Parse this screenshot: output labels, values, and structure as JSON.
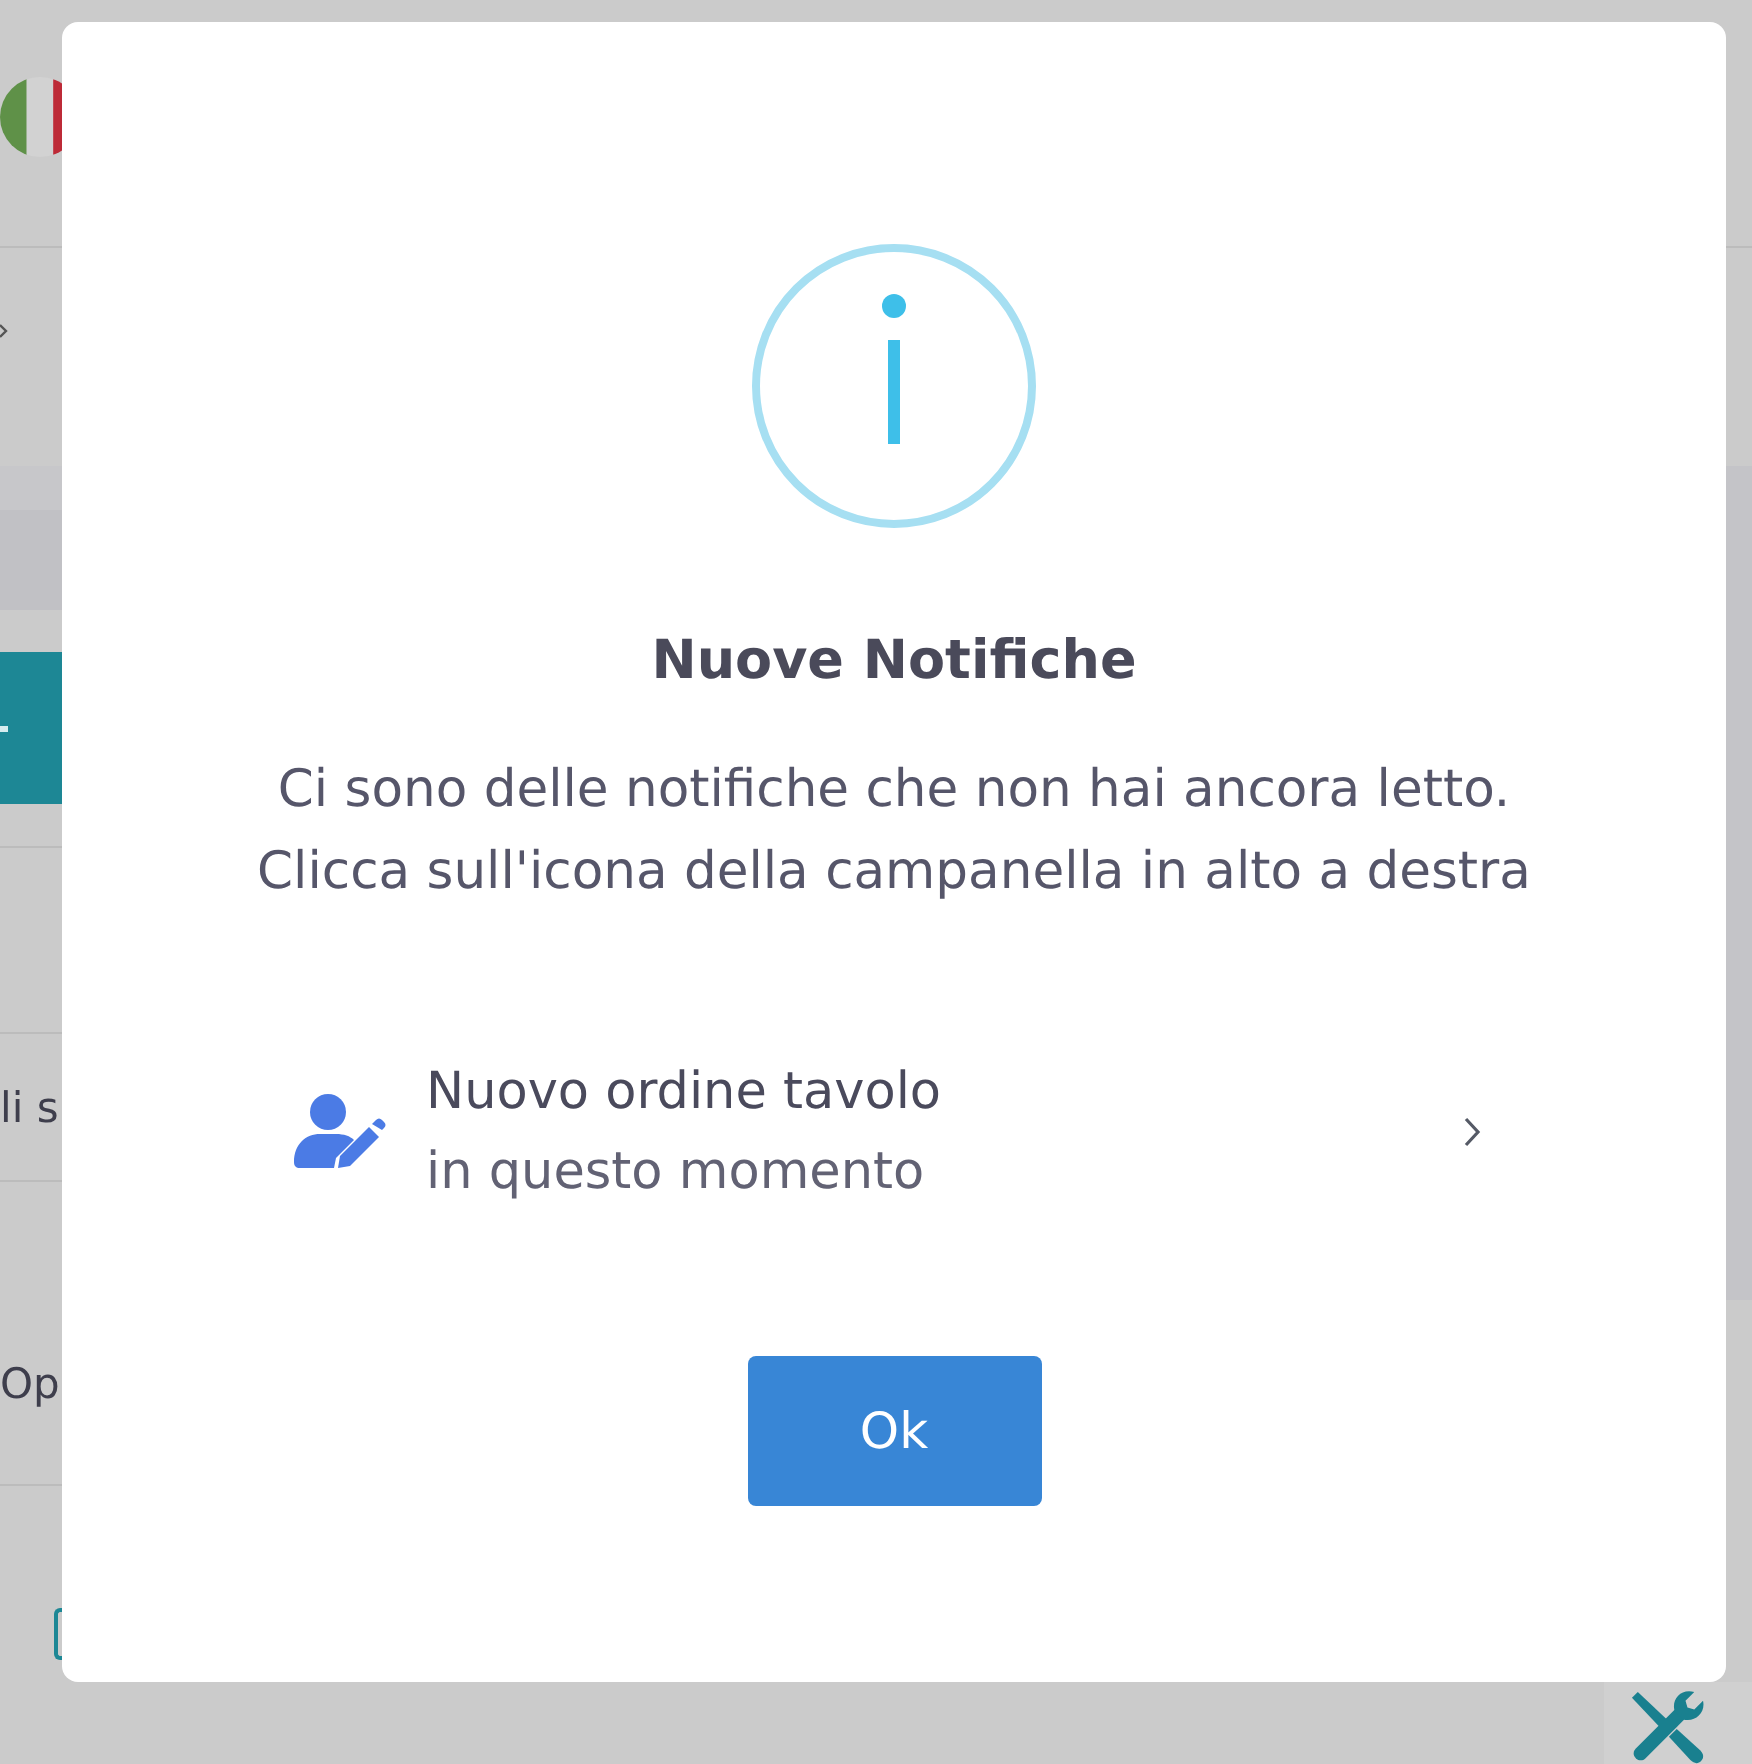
{
  "background": {
    "cells": [
      "li s",
      "Op"
    ],
    "checkbox": {
      "checked": false
    }
  },
  "dialog": {
    "title": "Nuove Notifiche",
    "message_lines": [
      "Ci sono delle notifiche che non hai ancora letto.",
      "Clicca sull'icona della campanella in alto a destra"
    ],
    "notifications": [
      {
        "title": "Nuovo ordine tavolo",
        "time": "in questo momento"
      }
    ],
    "buttons": [
      {
        "label": "Ok"
      }
    ]
  }
}
